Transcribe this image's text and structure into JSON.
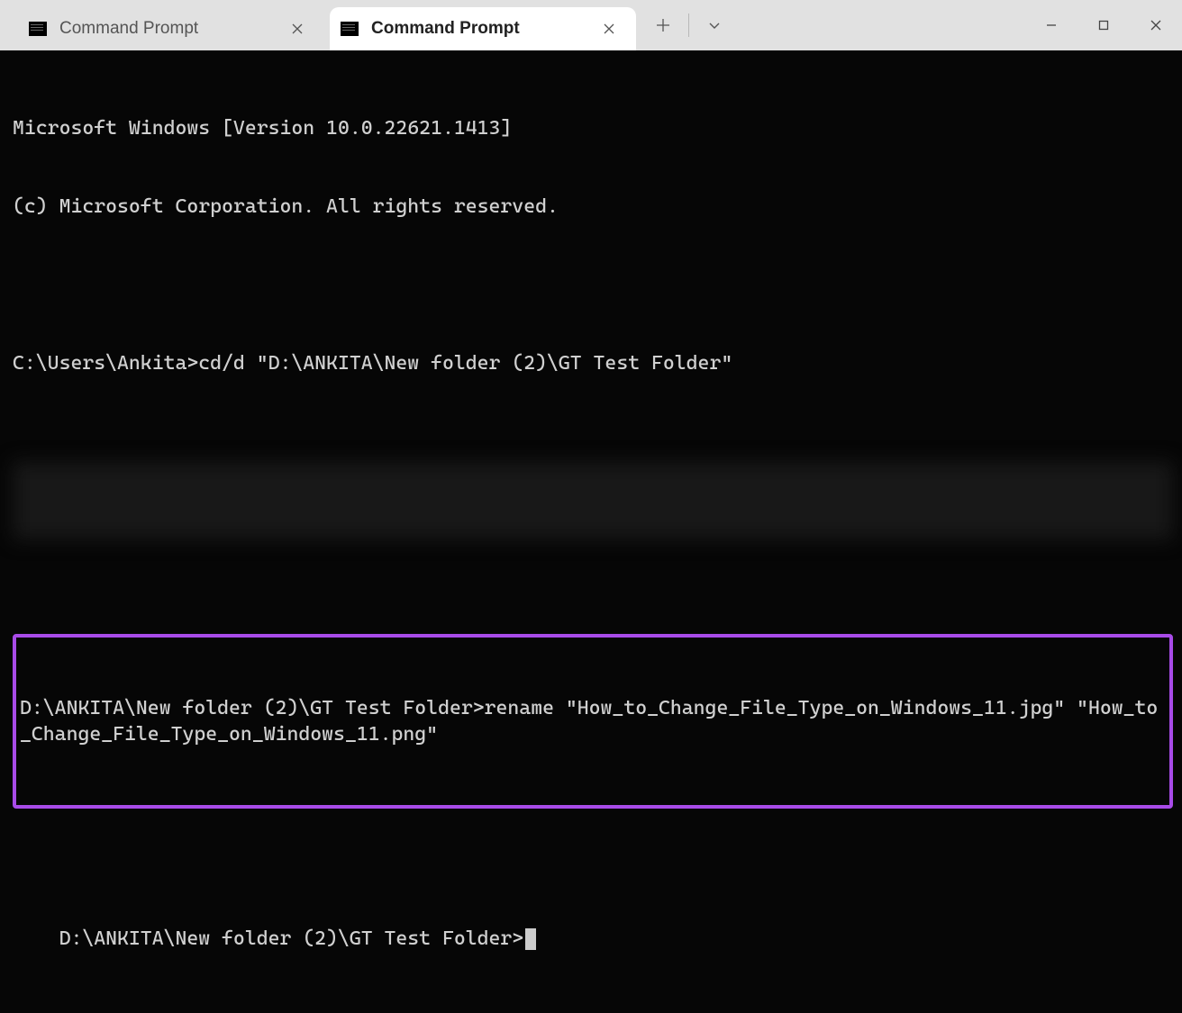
{
  "tabs": [
    {
      "title": "Command Prompt",
      "active": false
    },
    {
      "title": "Command Prompt",
      "active": true
    }
  ],
  "lines": {
    "banner1": "Microsoft Windows [Version 10.0.22621.1413]",
    "banner2": "(c) Microsoft Corporation. All rights reserved.",
    "prompt1": "C:\\Users\\Ankita>cd/d \"D:\\ANKITA\\New folder (2)\\GT Test Folder\"",
    "highlight": "D:\\ANKITA\\New folder (2)\\GT Test Folder>rename \"How_to_Change_File_Type_on_Windows_11.jpg\" \"How_to_Change_File_Type_on_Windows_11.png\"",
    "prompt2": "D:\\ANKITA\\New folder (2)\\GT Test Folder>"
  },
  "annotations": {
    "highlight_border_color": "#a84be8"
  }
}
